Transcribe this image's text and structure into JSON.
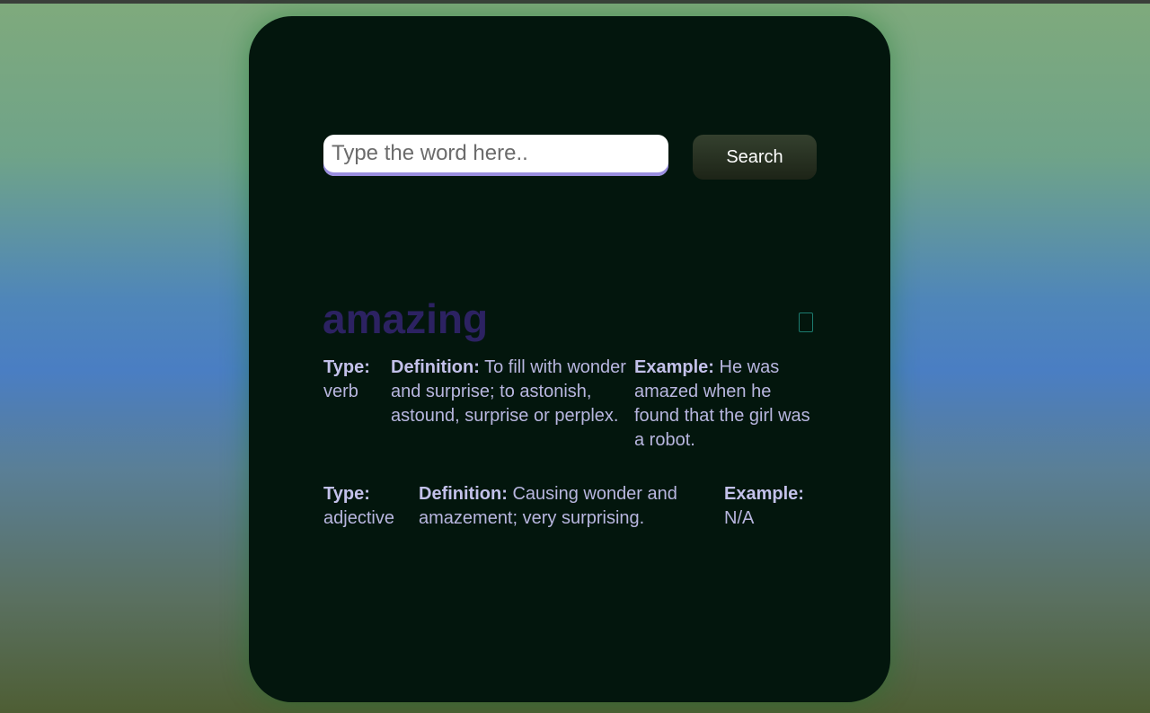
{
  "search": {
    "placeholder": "Type the word here..",
    "button_label": "Search"
  },
  "result": {
    "word": "amazing",
    "type_label": "Type:",
    "definition_label": "Definition:",
    "example_label": "Example:",
    "meanings": [
      {
        "type": "verb",
        "definition": "To fill with wonder and surprise; to astonish, astound, surprise or perplex.",
        "example": "He was amazed when he found that the girl was a robot."
      },
      {
        "type": "adjective",
        "definition": "Causing wonder and amazement; very surprising.",
        "example": "N/A"
      }
    ]
  },
  "icons": {
    "audio": "speaker-icon"
  },
  "colors": {
    "card_background": "#03160d",
    "word": "#2c2262",
    "text": "#b8b6df",
    "input_underline": "#9b8fe0",
    "button_background": "#2a3324"
  }
}
